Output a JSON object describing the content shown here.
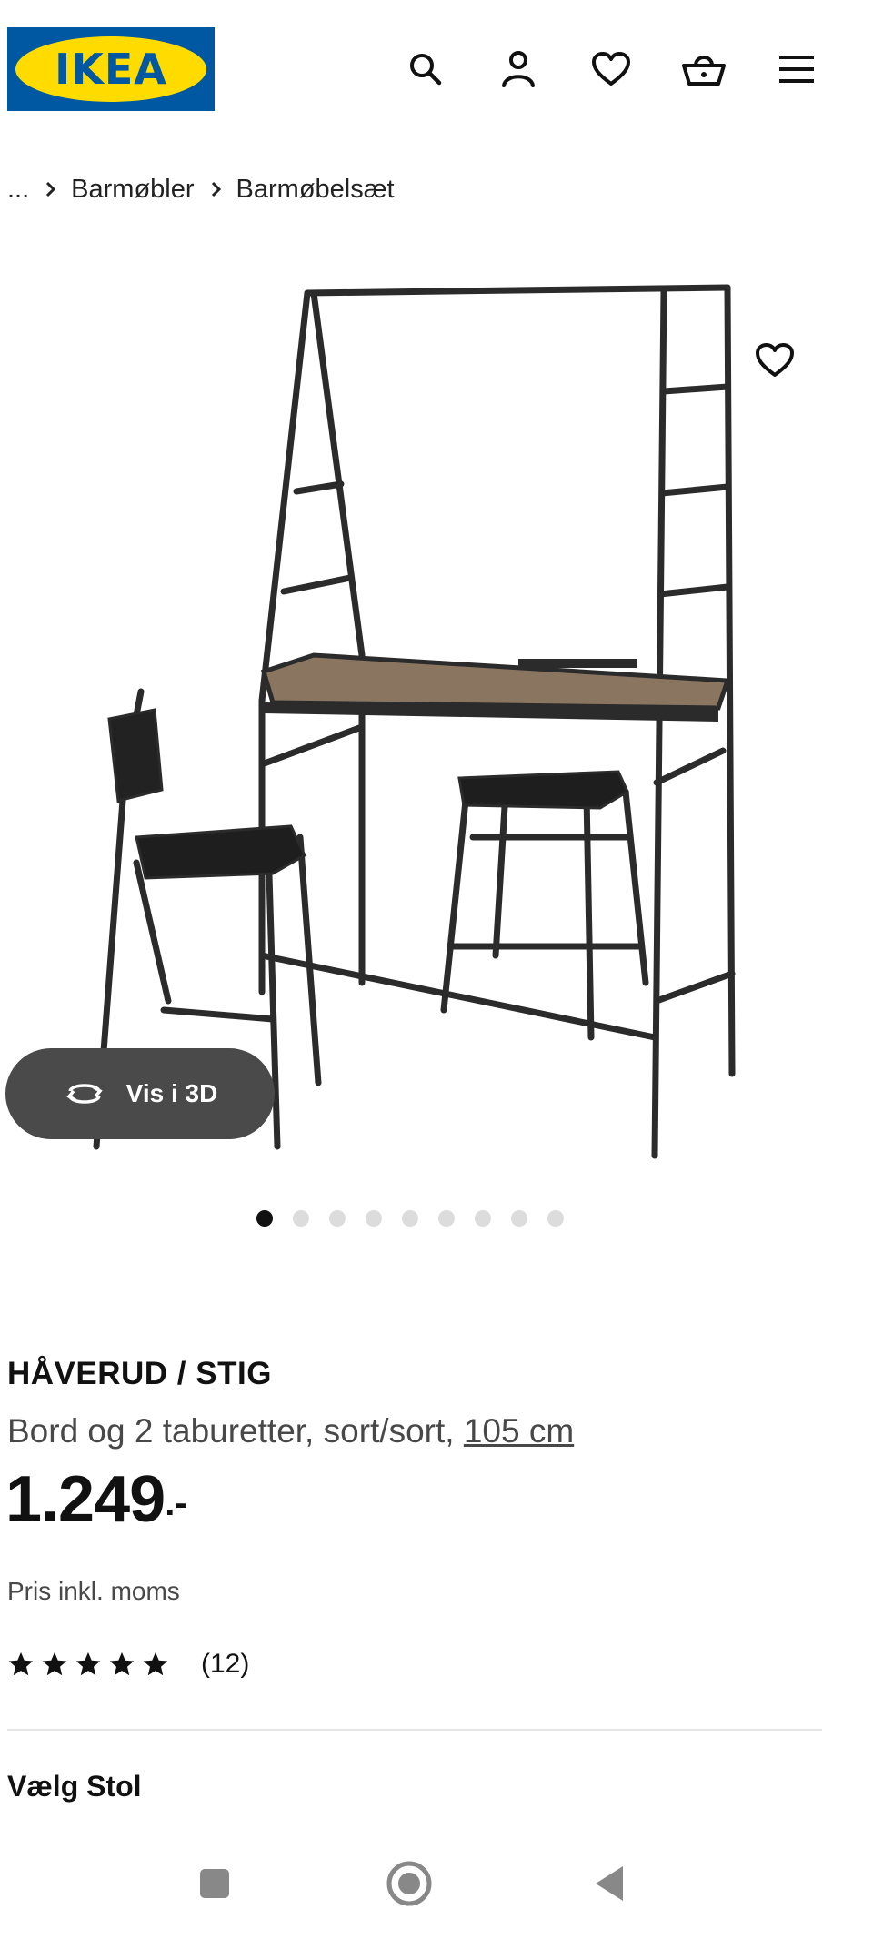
{
  "header": {
    "logo_text": "IKEA",
    "icons": [
      "search-icon",
      "user-icon",
      "heart-icon",
      "basket-icon",
      "menu-icon"
    ]
  },
  "breadcrumb": {
    "ellipsis": "...",
    "items": [
      "Barmøbler",
      "Barmøbelsæt"
    ]
  },
  "gallery": {
    "view_3d_label": "Vis i 3D",
    "dot_count": 9,
    "active_dot": 0
  },
  "product": {
    "name": "HÅVERUD / STIG",
    "description": "Bord og 2 taburetter, sort/sort,",
    "size": "105 cm",
    "price": "1.249",
    "price_suffix": ".-",
    "price_note": "Pris inkl. moms",
    "rating_stars": 5,
    "rating_count": "(12)"
  },
  "options": {
    "choose_label": "Vælg Stol"
  },
  "colors": {
    "brand_blue": "#0058a3",
    "brand_yellow": "#ffdb00",
    "text": "#111111",
    "muted": "#484848"
  }
}
